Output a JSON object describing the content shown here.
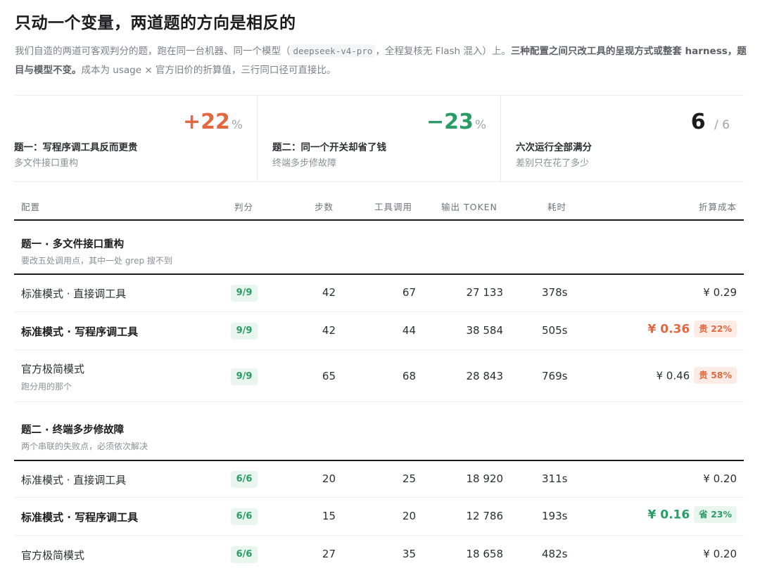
{
  "title": "只动一个变量，两道题的方向是相反的",
  "intro": {
    "p1": "我们自造的两道可客观判分的题，跑在同一台机器、同一个模型（",
    "model": "deepseek-v4-pro",
    "p2": "，全程复核无 Flash 混入）上。",
    "bold": "三种配置之间只改工具的呈现方式或整套 harness，题目与模型不变。",
    "p3": "成本为 usage × 官方旧价的折算值，三行同口径可直接比。"
  },
  "stats": [
    {
      "value": "+22",
      "unit": "%",
      "label": "题一：写程序调工具反而更贵",
      "sub": "多文件接口重构",
      "color": "#e1683f"
    },
    {
      "value": "−23",
      "unit": "%",
      "label": "题二：同一个开关却省了钱",
      "sub": "终端多步修故障",
      "color": "#2a9c66"
    },
    {
      "value": "6",
      "unit": "/ 6",
      "label": "六次运行全部满分",
      "sub": "差别只在花了多少",
      "color": "#1c1c1e"
    }
  ],
  "columns": {
    "config": "配置",
    "score": "判分",
    "steps": "步数",
    "tools": "工具调用",
    "output": "输出 TOKEN",
    "time": "耗时",
    "cost": "折算成本"
  },
  "sections": [
    {
      "title": "题一 · 多文件接口重构",
      "sub": "要改五处调用点，其中一处 grep 搜不到",
      "rows": [
        {
          "config": "标准模式 · 直接调工具",
          "config_sub": "",
          "score": "9/9",
          "steps": "42",
          "tools": "67",
          "output": "27 133",
          "time": "378s",
          "cost": "¥ 0.29",
          "tag": ""
        },
        {
          "config": "标准模式 · 写程序调工具",
          "config_sub": "",
          "score": "9/9",
          "steps": "42",
          "tools": "44",
          "output": "38 584",
          "time": "505s",
          "cost": "¥ 0.36",
          "tag": "贵 22%"
        },
        {
          "config": "官方极简模式",
          "config_sub": "跑分用的那个",
          "score": "9/9",
          "steps": "65",
          "tools": "68",
          "output": "28 843",
          "time": "769s",
          "cost": "¥ 0.46",
          "tag": "贵 58%"
        }
      ]
    },
    {
      "title": "题二 · 终端多步修故障",
      "sub": "两个串联的失败点，必须依次解决",
      "rows": [
        {
          "config": "标准模式 · 直接调工具",
          "config_sub": "",
          "score": "6/6",
          "steps": "20",
          "tools": "25",
          "output": "18 920",
          "time": "311s",
          "cost": "¥ 0.20",
          "tag": ""
        },
        {
          "config": "标准模式 · 写程序调工具",
          "config_sub": "",
          "score": "6/6",
          "steps": "15",
          "tools": "20",
          "output": "12 786",
          "time": "193s",
          "cost": "¥ 0.16",
          "tag": "省 23%"
        },
        {
          "config": "官方极简模式",
          "config_sub": "",
          "score": "6/6",
          "steps": "27",
          "tools": "35",
          "output": "18 658",
          "time": "482s",
          "cost": "¥ 0.20",
          "tag": ""
        }
      ]
    }
  ],
  "colors": {
    "red": "#e1683f",
    "green": "#2a9c66",
    "score_bg": "#e8f6ee"
  }
}
